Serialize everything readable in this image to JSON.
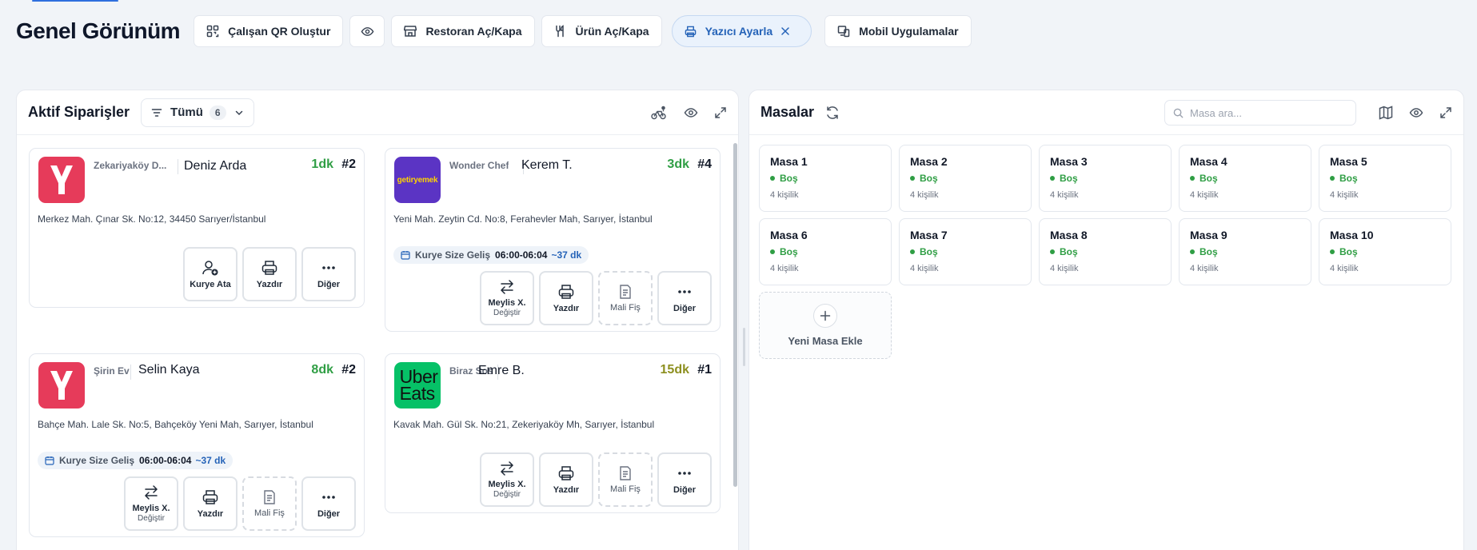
{
  "header": {
    "title": "Genel Görünüm",
    "buttons": {
      "staff_qr": "Çalışan QR Oluştur",
      "restaurant_toggle": "Restoran Aç/Kapa",
      "product_toggle": "Ürün Aç/Kapa",
      "printer_settings": "Yazıcı Ayarla",
      "mobile_apps": "Mobil Uygulamalar"
    }
  },
  "orders_panel": {
    "title": "Aktif Siparişler",
    "filter": {
      "label": "Tümü",
      "count": "6"
    },
    "orders": [
      {
        "platform": "yemeksepeti",
        "restaurant": "Zekariyaköy D...",
        "customer": "Deniz Arda",
        "elapsed": "1dk",
        "order_no": "#2",
        "address": "Merkez Mah. Çınar Sk. No:12, 34450 Sarıyer/İstanbul",
        "actions": [
          {
            "label": "Kurye Ata",
            "icon": "assign-courier-icon"
          },
          {
            "label": "Yazdır",
            "icon": "printer-icon"
          },
          {
            "label": "Diğer",
            "icon": "more-icon"
          }
        ]
      },
      {
        "platform": "getiryemek",
        "logo_text": "getiryemek",
        "restaurant": "Wonder Chef",
        "customer": "Kerem T.",
        "elapsed": "3dk",
        "order_no": "#4",
        "address": "Yeni Mah. Zeytin Cd. No:8, Ferahevler Mah, Sarıyer, İstanbul",
        "courier": {
          "label": "Kurye Size Geliş",
          "window": "06:00-06:04",
          "eta": "~37 dk"
        },
        "actions": [
          {
            "label": "Meylis X.",
            "sub": "Değiştir",
            "icon": "swap-icon"
          },
          {
            "label": "Yazdır",
            "icon": "printer-icon"
          },
          {
            "label": "Mali Fiş",
            "icon": "receipt-icon"
          },
          {
            "label": "Diğer",
            "icon": "more-icon"
          }
        ]
      },
      {
        "platform": "yemeksepeti",
        "restaurant": "Şirin Ev",
        "customer": "Selin Kaya",
        "elapsed": "8dk",
        "order_no": "#2",
        "address": "Bahçe Mah. Lale Sk. No:5, Bahçeköy Yeni Mah, Sarıyer, İstanbul",
        "courier": {
          "label": "Kurye Size Geliş",
          "window": "06:00-06:04",
          "eta": "~37 dk"
        },
        "actions": [
          {
            "label": "Meylis X.",
            "sub": "Değiştir",
            "icon": "swap-icon"
          },
          {
            "label": "Yazdır",
            "icon": "printer-icon"
          },
          {
            "label": "Mali Fiş",
            "icon": "receipt-icon"
          },
          {
            "label": "Diğer",
            "icon": "more-icon"
          }
        ]
      },
      {
        "platform": "ubereats",
        "logo_text_1": "Uber",
        "logo_text_2": "Eats",
        "restaurant": "Biraz Sos",
        "customer": "Emre B.",
        "elapsed": "15dk",
        "order_no": "#1",
        "address": "Kavak Mah. Gül Sk. No:21, Zekeriyaköy Mh, Sarıyer, İstanbul",
        "actions": [
          {
            "label": "Meylis X.",
            "sub": "Değiştir",
            "icon": "swap-icon"
          },
          {
            "label": "Yazdır",
            "icon": "printer-icon"
          },
          {
            "label": "Mali Fiş",
            "icon": "receipt-icon"
          },
          {
            "label": "Diğer",
            "icon": "more-icon"
          }
        ]
      }
    ]
  },
  "tables_panel": {
    "title": "Masalar",
    "search_placeholder": "Masa ara...",
    "tables": [
      {
        "name": "Masa 1",
        "status": "Boş",
        "capacity": "4 kişilik"
      },
      {
        "name": "Masa 2",
        "status": "Boş",
        "capacity": "4 kişilik"
      },
      {
        "name": "Masa 3",
        "status": "Boş",
        "capacity": "4 kişilik"
      },
      {
        "name": "Masa 4",
        "status": "Boş",
        "capacity": "4 kişilik"
      },
      {
        "name": "Masa 5",
        "status": "Boş",
        "capacity": "4 kişilik"
      },
      {
        "name": "Masa 6",
        "status": "Boş",
        "capacity": "4 kişilik"
      },
      {
        "name": "Masa 7",
        "status": "Boş",
        "capacity": "4 kişilik"
      },
      {
        "name": "Masa 8",
        "status": "Boş",
        "capacity": "4 kişilik"
      },
      {
        "name": "Masa 9",
        "status": "Boş",
        "capacity": "4 kişilik"
      },
      {
        "name": "Masa 10",
        "status": "Boş",
        "capacity": "4 kişilik"
      }
    ],
    "add_label": "Yeni Masa Ekle"
  },
  "colors": {
    "accent": "#2563b8",
    "status_free": "#2f9e44",
    "yemeksepeti": "#e63b5a",
    "getir": "#5b34c4",
    "ubereats": "#06c167"
  }
}
